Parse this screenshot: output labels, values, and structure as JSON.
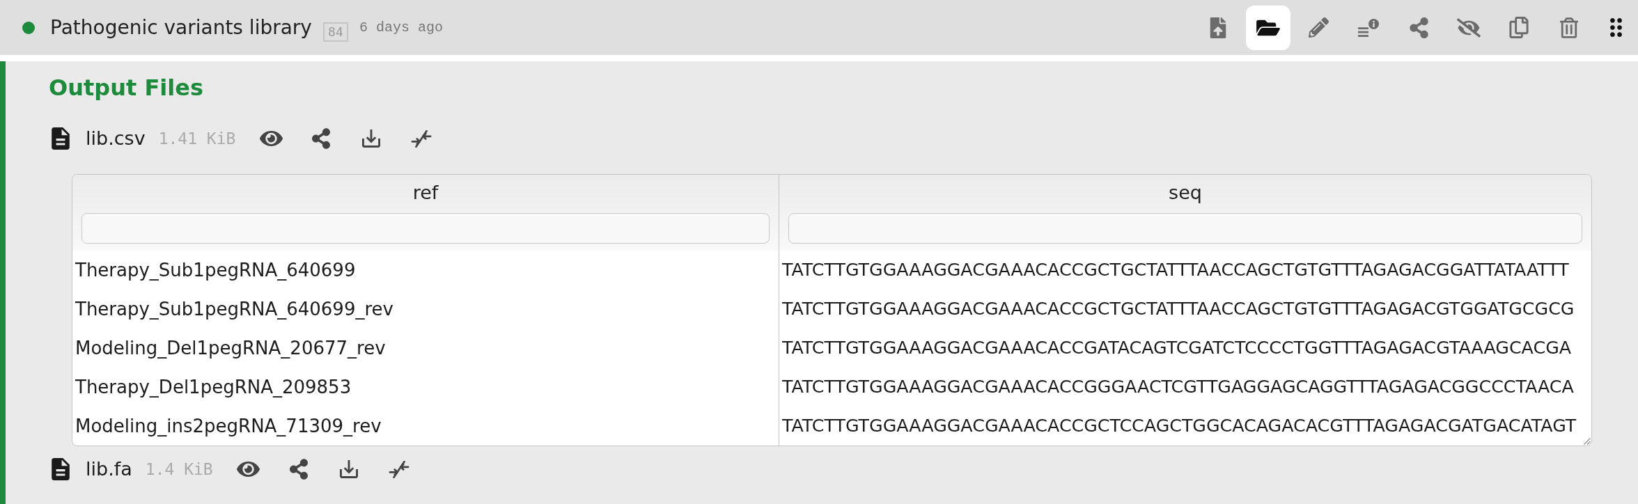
{
  "dataset": {
    "status_ok": true,
    "title": "Pathogenic variants library",
    "hid": "84",
    "time": "6 days ago"
  },
  "toolbar": [
    {
      "selected": false
    },
    {
      "selected": true
    },
    {
      "selected": false
    },
    {
      "selected": false
    },
    {
      "selected": false
    },
    {
      "selected": false
    },
    {
      "selected": false
    },
    {
      "selected": false
    }
  ],
  "section_title": "Output Files",
  "files": [
    {
      "name": "lib.csv",
      "size": "1.41 KiB",
      "table": {
        "columns": [
          "ref",
          "seq"
        ],
        "rows": [
          [
            "Therapy_Sub1pegRNA_640699",
            "TATCTTGTGGAAAGGACGAAACACCGCTGCTATTTAACCAGCTGTGTTTAGAGACGGATTATAATTT"
          ],
          [
            "Therapy_Sub1pegRNA_640699_rev",
            "TATCTTGTGGAAAGGACGAAACACCGCTGCTATTTAACCAGCTGTGTTTAGAGACGTGGATGCGCG"
          ],
          [
            "Modeling_Del1pegRNA_20677_rev",
            "TATCTTGTGGAAAGGACGAAACACCGATACAGTCGATCTCCCCTGGTTTAGAGACGTAAAGCACGA"
          ],
          [
            "Therapy_Del1pegRNA_209853",
            "TATCTTGTGGAAAGGACGAAACACCGGGAACTCGTTGAGGAGCAGGTTTAGAGACGGCCCTAACA"
          ],
          [
            "Modeling_ins2pegRNA_71309_rev",
            "TATCTTGTGGAAAGGACGAAACACCGCTCCAGCTGGCACAGACACGTTTAGAGACGATGACATAGT"
          ]
        ]
      }
    },
    {
      "name": "lib.fa",
      "size": "1.4 KiB"
    }
  ]
}
